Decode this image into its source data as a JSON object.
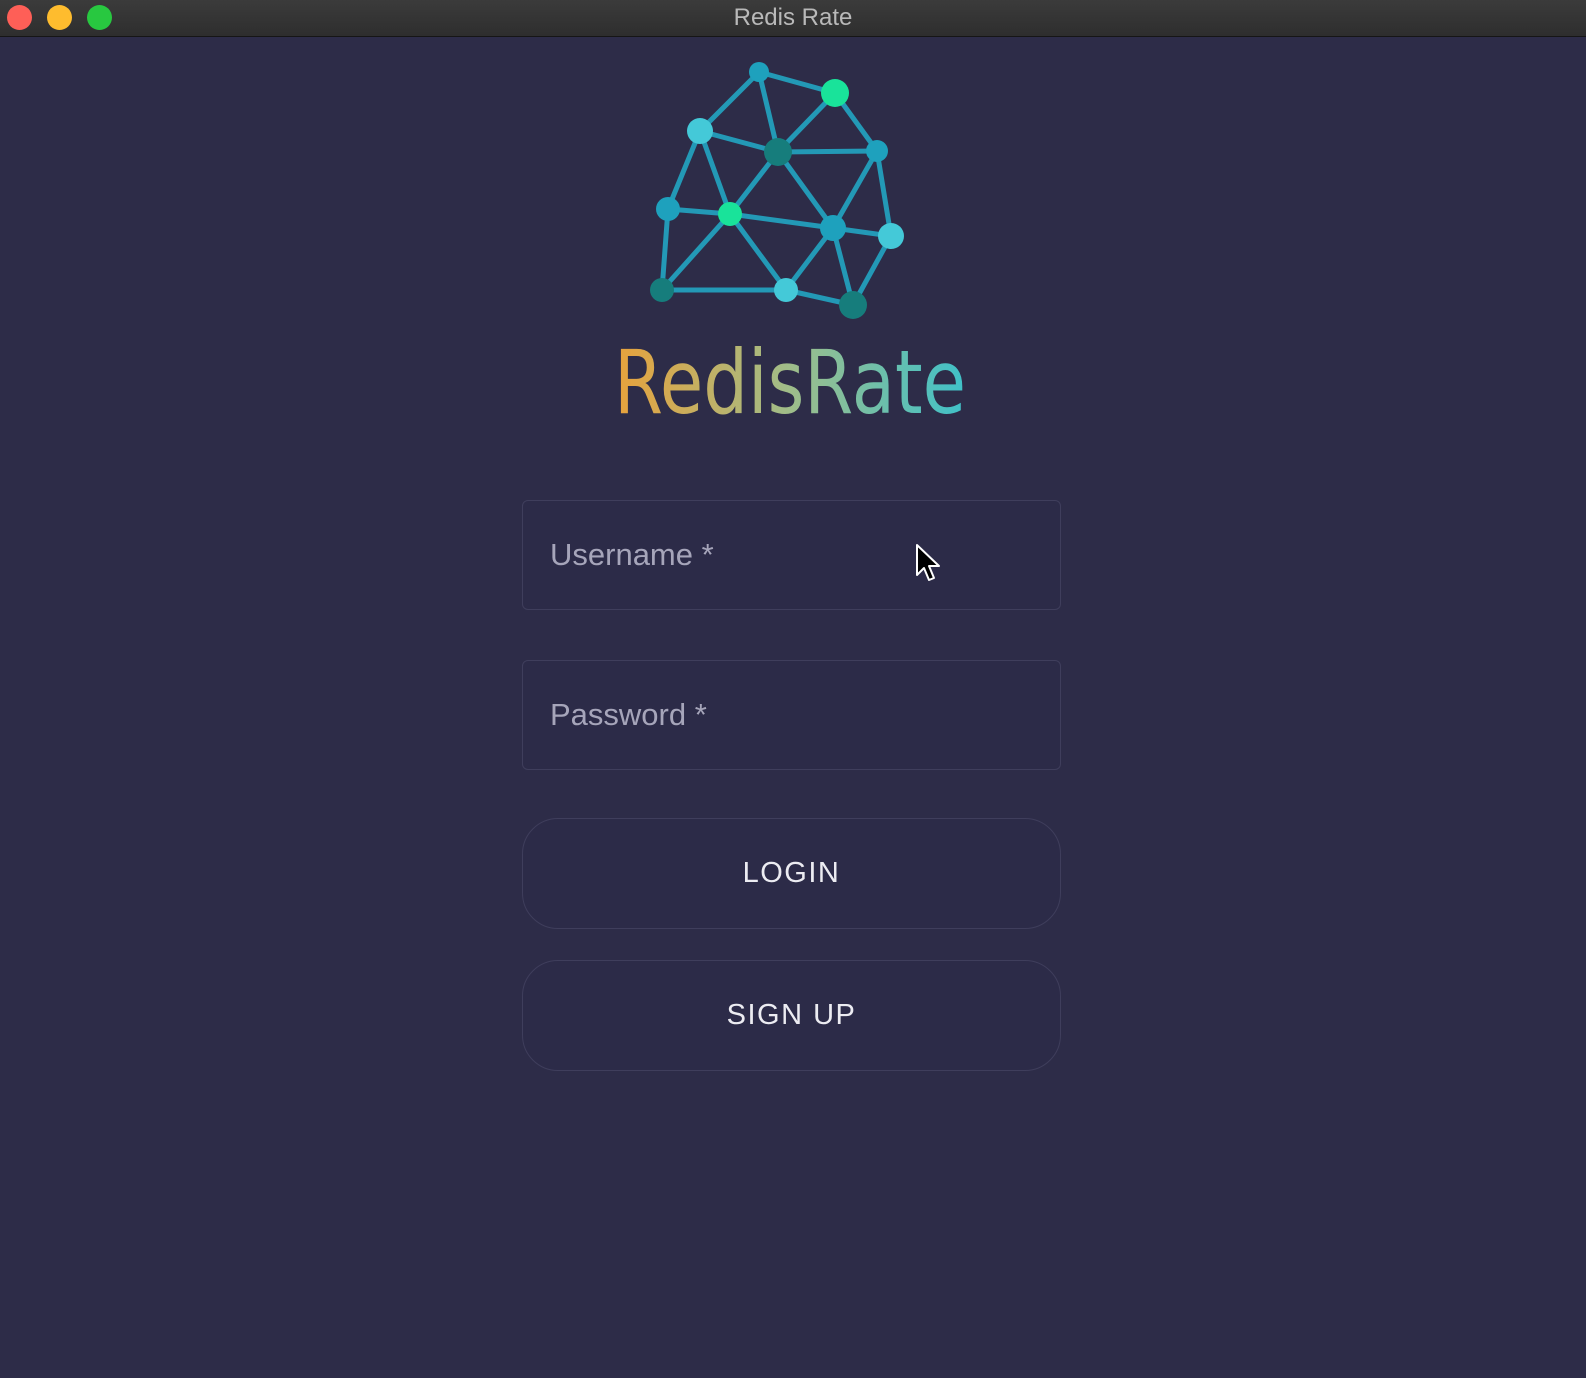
{
  "window": {
    "title": "Redis Rate",
    "controls": {
      "close_color": "#fe5f57",
      "minimize_color": "#febc2e",
      "maximize_color": "#28c840"
    }
  },
  "logo": {
    "icon": "network-graph-icon",
    "wordmark": "RedisRate",
    "wordmark_gradient": [
      "#e9a23b",
      "#9fbd8a",
      "#3fc1c9"
    ],
    "node_colors": [
      "#1ea1bd",
      "#44c9d8",
      "#19e39a",
      "#167d7c"
    ],
    "edge_color": "#2399b6"
  },
  "form": {
    "username": {
      "placeholder": "Username *",
      "value": ""
    },
    "password": {
      "placeholder": "Password *",
      "value": ""
    },
    "login_label": "LOGIN",
    "signup_label": "SIGN UP"
  },
  "theme": {
    "background": "#2d2c48",
    "field_border": "#3f3e5c"
  }
}
